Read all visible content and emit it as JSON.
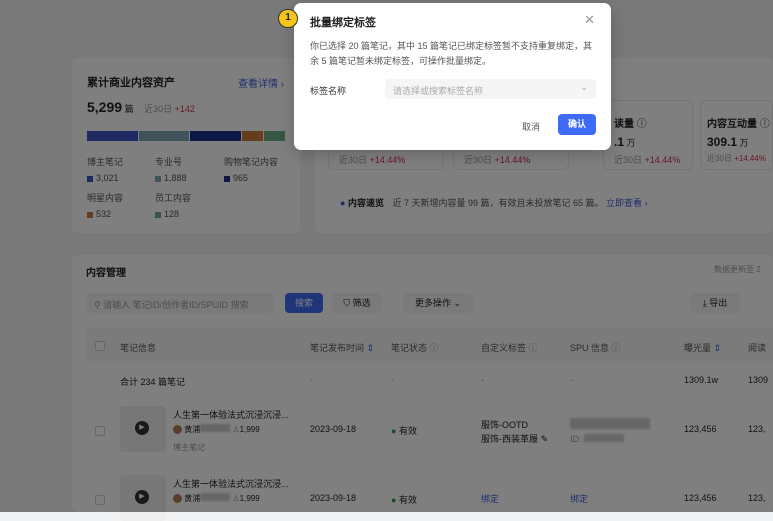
{
  "assets": {
    "title": "累计商业内容资产",
    "detail_link": "查看详情 ›",
    "total": "5,299",
    "unit": "篇",
    "period": "近30日",
    "delta": "+142",
    "segments": [
      {
        "label": "博主笔记",
        "value": "3,021",
        "color": "#3b55c4"
      },
      {
        "label": "专业号",
        "value": "1,888",
        "color": "#7fa6b5"
      },
      {
        "label": "购物笔记内容",
        "value": "965",
        "color": "#1f2f8a"
      },
      {
        "label": "明星内容",
        "value": "532",
        "color": "#c77a3a"
      },
      {
        "label": "员工内容",
        "value": "128",
        "color": "#6fae84"
      }
    ]
  },
  "metrics": [
    {
      "label": "",
      "value": "",
      "period": "近30日",
      "delta": "+14.44%"
    },
    {
      "label": "",
      "value": "",
      "period": "近30日",
      "delta": "+14.44%"
    },
    {
      "label": "读量",
      "value": ".1",
      "unit": "万",
      "period": "近30日",
      "delta": "+14.44%"
    },
    {
      "label": "内容互动量",
      "value": "309.1",
      "unit": "万",
      "period": "近30日",
      "delta": "+14.44%"
    }
  ],
  "insight": {
    "title": "内容速览",
    "text": "近 7 天新增内容量 99 篇，有效且未投放笔记 65 篇。",
    "link": "立即查看 ›"
  },
  "content": {
    "title": "内容管理",
    "update_text": "数据更新至 2",
    "search_placeholder": "请输入 笔记ID/创作者ID/SPUID 搜索",
    "search_btn": "搜索",
    "filter_btn": "筛选",
    "more_btn": "更多操作",
    "export_btn": "导出",
    "columns": [
      "笔记信息",
      "笔记发布时间",
      "笔记状态",
      "自定义标签",
      "SPU 信息",
      "曝光量",
      "阅读"
    ],
    "total_row": {
      "label": "合计 234 篇笔记",
      "dash": "-",
      "exposure": "1309.1w",
      "read": "1309"
    },
    "rows": [
      {
        "title": "人生第一体验法式沉浸沉浸...",
        "author": "黄浦",
        "fans": "1,999",
        "type": "博主笔记",
        "date": "2023-09-18",
        "status": "有效",
        "tags": [
          "服饰-OOTD",
          "服饰-西装革履"
        ],
        "spu_id": "ID:",
        "exposure": "123,456",
        "read": "123,"
      },
      {
        "title": "人生第一体验法式沉浸沉浸...",
        "author": "黄浦",
        "fans": "1,999",
        "date": "2023-09-18",
        "status": "有效",
        "tag_link": "绑定",
        "spu_link": "绑定",
        "exposure": "123,456",
        "read": "123,"
      }
    ]
  },
  "modal": {
    "step": "1",
    "title": "批量绑定标签",
    "message": "你已选择 20 篇笔记，其中 15 篇笔记已绑定标签暂不支持重复绑定，其余 5 篇笔记暂未绑定标签，可操作批量绑定。",
    "field_label": "标签名称",
    "select_placeholder": "请选择或搜索标签名称",
    "cancel": "取消",
    "confirm": "确认",
    "accent": "#3d6bf5"
  }
}
